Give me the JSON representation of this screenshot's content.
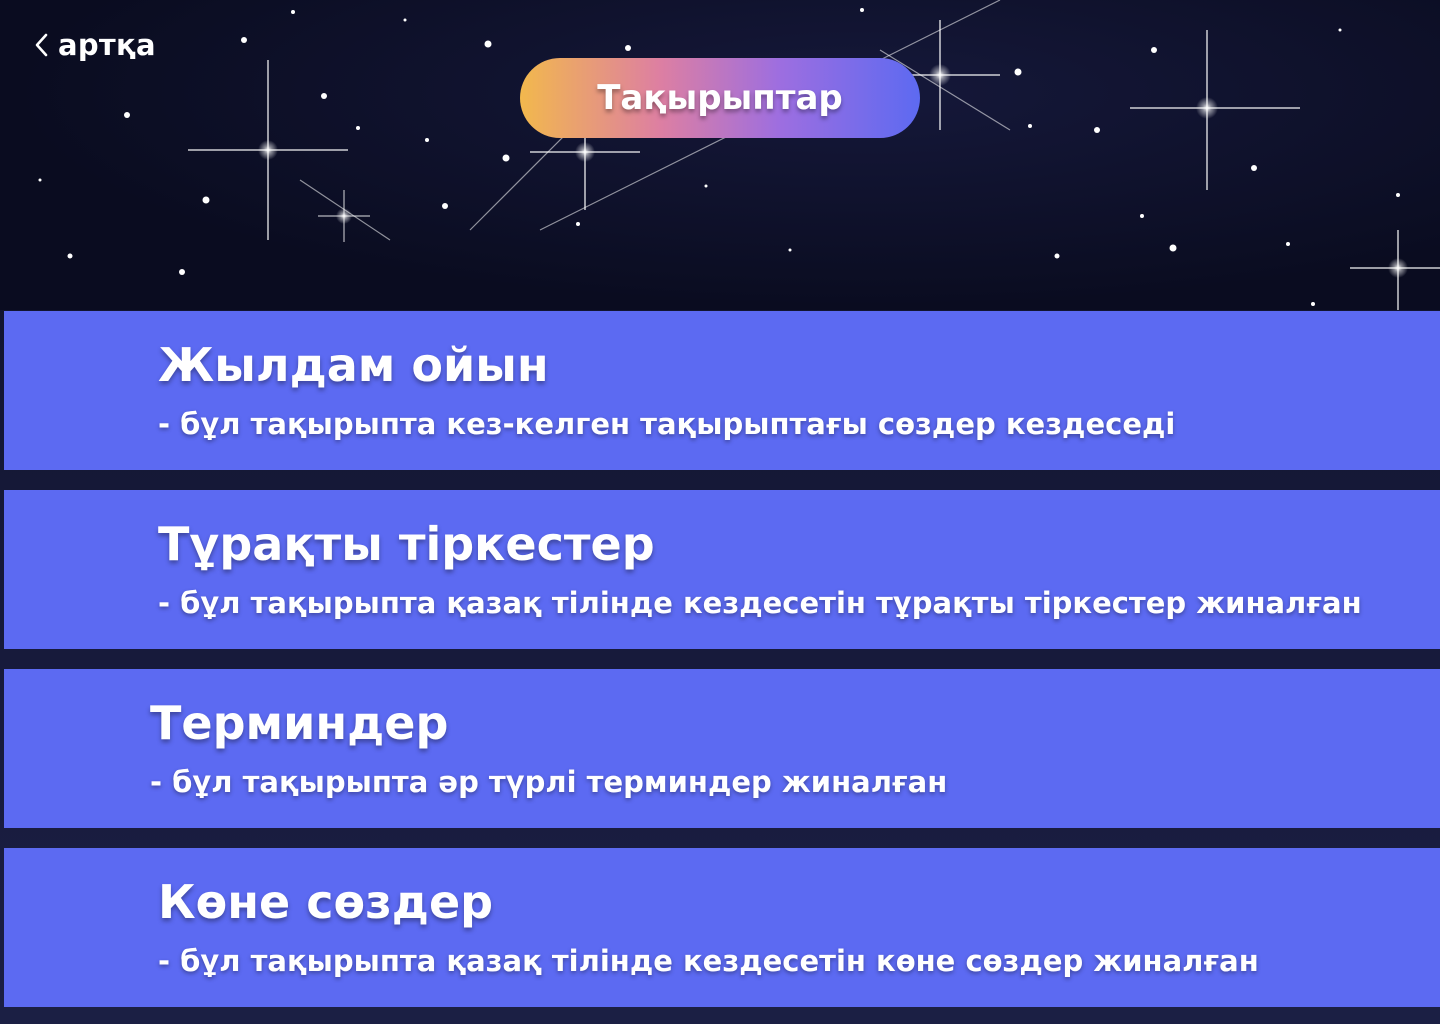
{
  "nav": {
    "back_label": "артқа"
  },
  "header": {
    "title": "Тақырыптар"
  },
  "topics": [
    {
      "title": "Жылдам ойын",
      "description": "- бұл тақырыпта кез-келген тақырыптағы сөздер кездеседі"
    },
    {
      "title": "Тұрақты тіркестер",
      "description": "- бұл тақырыпта қазақ тілінде кездесетін тұрақты тіркестер жиналған"
    },
    {
      "title": "Терминдер",
      "description": "- бұл тақырыпта әр түрлі терминдер жиналған"
    },
    {
      "title": "Көне сөздер",
      "description": "- бұл тақырыпта қазақ тілінде кездесетін көне сөздер жиналған"
    }
  ],
  "colors": {
    "background": "#12152f",
    "card": "#5c6af2",
    "pill_gradient_start": "#f2b84d",
    "pill_gradient_end": "#5d6af1",
    "text": "#ffffff"
  },
  "icons": {
    "back": "chevron-left-icon",
    "moon": "crescent-moon-icon",
    "stars": "star-icon"
  }
}
